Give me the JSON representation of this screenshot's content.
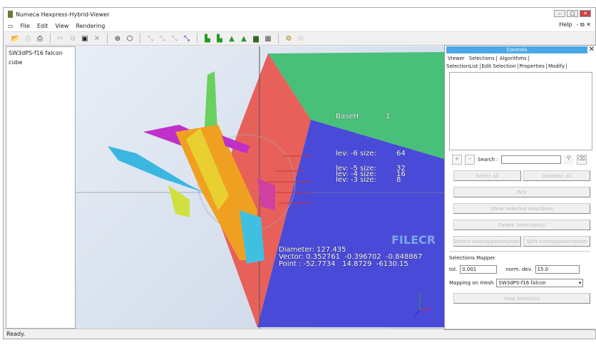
{
  "window": {
    "title": "Numeca Hexpress-Hybrid-Viewer"
  },
  "menu": {
    "items": [
      "File",
      "Edit",
      "View",
      "Rendering"
    ],
    "help": "Help",
    "right_icons": "- ⧉ ✕"
  },
  "toolbar": {
    "icons": [
      "open-icon",
      "print-disabled-icon",
      "print-icon",
      "cut-icon",
      "copy-icon",
      "paste-icon",
      "delete-icon",
      "render-icon",
      "cube-icon",
      "axis-x-icon",
      "axis-y-icon",
      "axis-z-icon",
      "axis-iso-icon",
      "mesh1-icon",
      "mesh2-icon",
      "mesh3-icon",
      "mesh4-icon",
      "mesh5-icon",
      "mesh6-icon",
      "settings-icon",
      "help-icon"
    ]
  },
  "tree": {
    "items": [
      "SW3dPS-f16 falcon",
      "cube"
    ]
  },
  "viewport": {
    "baseh_label": "BaseH :",
    "baseh_value": "1",
    "levels": [
      {
        "label": "lev: -6 size:",
        "value": "64"
      },
      {
        "label": "lev: -5 size:",
        "value": "32"
      },
      {
        "label": "lev: -4 size:",
        "value": "16"
      },
      {
        "label": "lev: -3 size:",
        "value": "8"
      }
    ],
    "diameter": "Diameter: 127.435",
    "vector": "Vector: 0.352761  -0.396702  -0.848867",
    "point": "Point : -52.7734   14.8729  -6130.15",
    "watermark": "FILECR",
    "colors": {
      "red": "#e8605a",
      "green": "#48c07a",
      "blue": "#4a4ad8"
    }
  },
  "controls": {
    "title": "Controls",
    "tabs": [
      "Viewer",
      "Selections",
      "Algorithms"
    ],
    "subtabs": [
      "SelectionList",
      "Edit Selection",
      "Properties",
      "Modify"
    ],
    "search_label": "Search :",
    "search_value": "",
    "buttons": {
      "select_all": "Select all",
      "unselect_all": "Unselect all",
      "pick": "Pick",
      "show": "Show selected selections",
      "delete": "Delete Selection(s)",
      "detect": "Detect overlapped/orphan",
      "split": "Split overlapped/orphan",
      "map": "map Selection"
    },
    "mapper": {
      "title": "Selections Mapper",
      "tol_label": "tol.",
      "tol_value": "0.001",
      "norm_label": "norm. dev.",
      "norm_value": "15.0",
      "mesh_label": "Mapping on mesh",
      "mesh_value": "SW3dPS-f16 falcon"
    }
  },
  "status": "Ready."
}
